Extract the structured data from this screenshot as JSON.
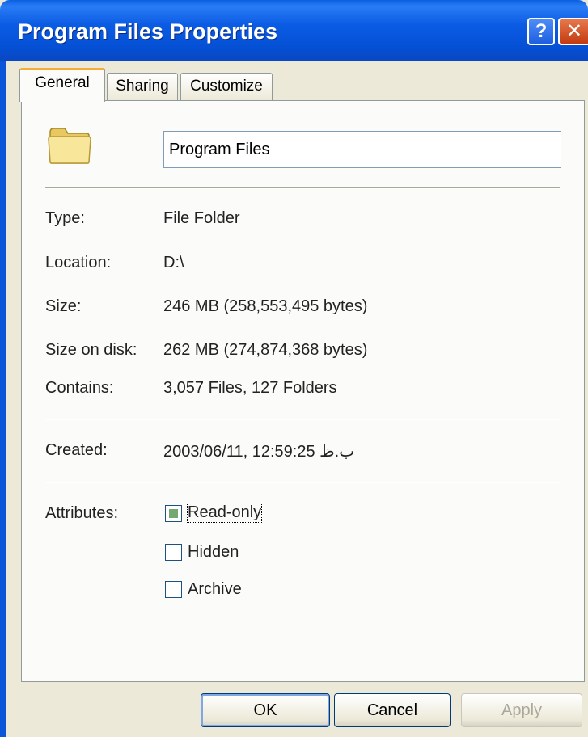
{
  "window": {
    "title": "Program Files Properties",
    "help_glyph": "?",
    "close_glyph": "✕"
  },
  "tabs": [
    {
      "label": "General",
      "active": true
    },
    {
      "label": "Sharing",
      "active": false
    },
    {
      "label": "Customize",
      "active": false
    }
  ],
  "general": {
    "folder_name": "Program Files",
    "icon": "folder-icon",
    "properties": [
      {
        "label": "Type:",
        "value": "File Folder"
      },
      {
        "label": "Location:",
        "value": "D:\\"
      },
      {
        "label": "Size:",
        "value": "246 MB (258,553,495 bytes)"
      },
      {
        "label": "Size on disk:",
        "value": "262 MB (274,874,368 bytes)"
      },
      {
        "label": "Contains:",
        "value": "3,057 Files, 127 Folders"
      }
    ],
    "created": {
      "label": "Created:",
      "value": "2003/06/11, 12:59:25 ب.ظ"
    },
    "attributes": {
      "label": "Attributes:",
      "items": [
        {
          "label": "Read-only",
          "state": "indeterminate"
        },
        {
          "label": "Hidden",
          "state": "unchecked"
        },
        {
          "label": "Archive",
          "state": "unchecked"
        }
      ]
    }
  },
  "buttons": {
    "ok": "OK",
    "cancel": "Cancel",
    "apply": "Apply"
  },
  "colors": {
    "titlebar": "#0551d6",
    "dialog_bg": "#ece9d8",
    "active_tab_accent": "#f5ad3a",
    "checkbox_indeterminate": "#73a873"
  }
}
